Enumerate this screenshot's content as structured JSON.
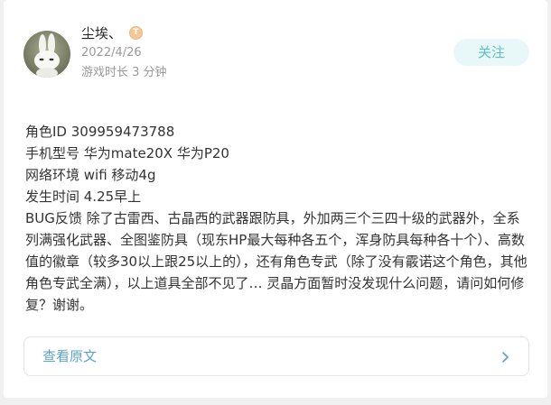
{
  "user": {
    "name": "尘埃、",
    "level_badge": "T",
    "date": "2022/4/26",
    "playtime": "游戏时长 3 分钟"
  },
  "follow_button": "关注",
  "post": {
    "lines": [
      "角色ID 309959473788",
      "手机型号 华为mate20X 华为P20",
      "网络环境 wifi 移动4g",
      "发生时间 4.25早上"
    ],
    "body": "BUG反馈 除了古雷西、古晶西的武器跟防具，外加两三个三四十级的武器外，全系列满强化武器、全图鉴防具（现东HP最大每种各五个，浑身防具每种各十个）、高数值的徽章（较多30以上跟25以上的），还有角色专武（除了没有霰诺这个角色，其他角色专武全满），以上道具全部不见了… 灵晶方面暂时没发现什么问题，请问如何修复？谢谢。"
  },
  "view_original": {
    "label": "查看原文"
  },
  "colors": {
    "accent": "#5dbfc8",
    "link": "#5aa3d9",
    "follow_bg": "#e8f7f8",
    "badge": "#f4c795"
  },
  "icons": {
    "avatar": "avatar-image",
    "chevron": "chevron-right-icon"
  }
}
